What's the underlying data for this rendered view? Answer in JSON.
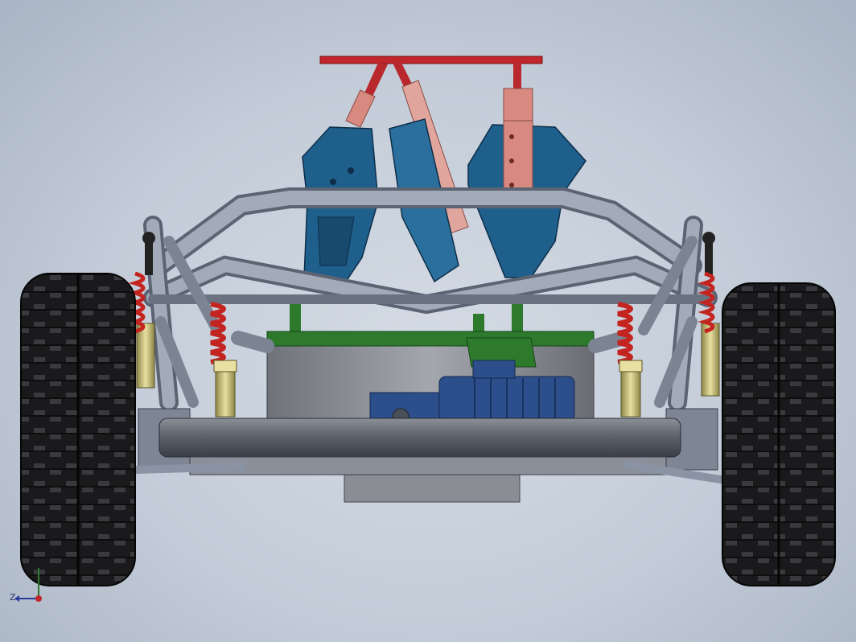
{
  "view": {
    "background": "#c8d0dc",
    "colors": {
      "frame_tube": "#8e97a8",
      "frame_tube_dark": "#5c6474",
      "tire": "#1a1a1c",
      "spring": "#c42420",
      "damper_body": "#c8c07a",
      "actuator_blue": "#1f5f8c",
      "actuator_pink": "#d88a80",
      "top_bar_red": "#c0262a",
      "base_green": "#2d7a2d",
      "motor_blue": "#2c4e8a",
      "gray_box": "#8a8d94"
    }
  },
  "triad": {
    "z_label": "Z",
    "icons": [
      "coordinate-triad-icon"
    ]
  }
}
